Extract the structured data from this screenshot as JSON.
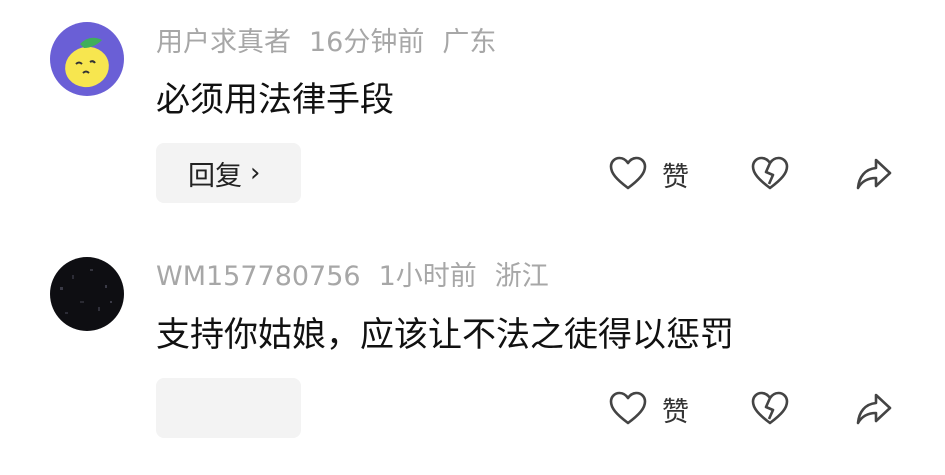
{
  "comments": [
    {
      "username": "用户求真者",
      "time": "16分钟前",
      "location": "广东",
      "text": "必须用法律手段",
      "reply_label": "回复",
      "reply_chevron": "›",
      "like_label": "赞",
      "avatar": "lemon-avatar"
    },
    {
      "username": "WM157780756",
      "time": "1小时前",
      "location": "浙江",
      "text": "支持你姑娘，应该让不法之徒得以惩罚",
      "reply_label": "",
      "like_label": "赞",
      "avatar": "dark-avatar"
    }
  ],
  "colors": {
    "meta": "#a7a7a7",
    "text": "#111111",
    "reply_bg": "#f3f3f3",
    "icon": "#444444",
    "avatar_bg": "#6a5fd6",
    "lemon": "#f7e64f"
  },
  "icons": [
    "heart-icon",
    "broken-heart-icon",
    "share-arrow-icon"
  ]
}
